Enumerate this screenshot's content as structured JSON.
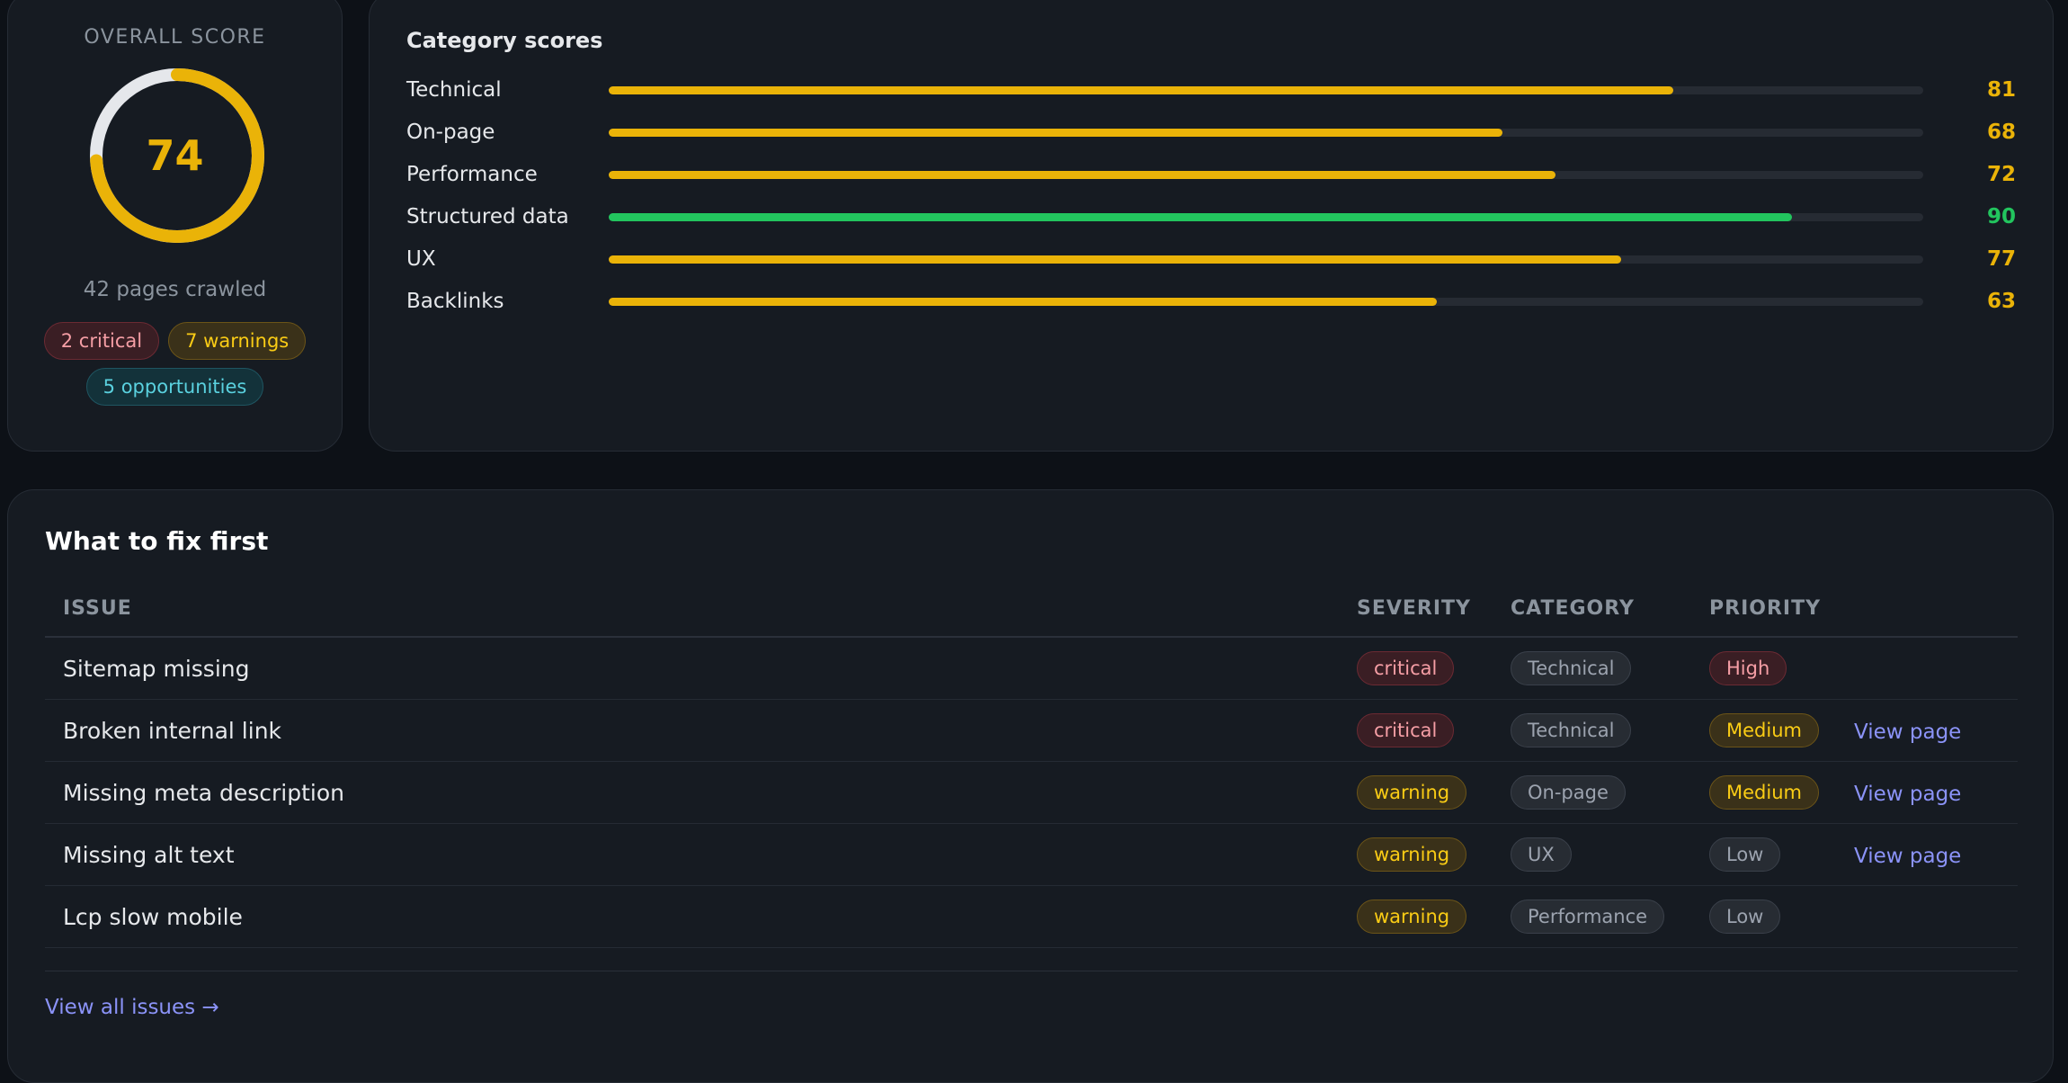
{
  "overall": {
    "title": "OVERALL SCORE",
    "score": 74,
    "score_label": "74",
    "pages_crawled": "42 pages crawled",
    "badges": {
      "critical": "2 critical",
      "warnings": "7 warnings",
      "opportunities": "5 opportunities"
    },
    "ring_color": "#eab308",
    "ring_track_color": "#e5e7eb"
  },
  "categories": {
    "title": "Category scores",
    "max": 100,
    "items": [
      {
        "label": "Technical",
        "value": 81,
        "value_text": "81",
        "color": "#eab308"
      },
      {
        "label": "On-page",
        "value": 68,
        "value_text": "68",
        "color": "#eab308"
      },
      {
        "label": "Performance",
        "value": 72,
        "value_text": "72",
        "color": "#eab308"
      },
      {
        "label": "Structured data",
        "value": 90,
        "value_text": "90",
        "color": "#22c55e"
      },
      {
        "label": "UX",
        "value": 77,
        "value_text": "77",
        "color": "#eab308"
      },
      {
        "label": "Backlinks",
        "value": 63,
        "value_text": "63",
        "color": "#eab308"
      }
    ]
  },
  "fix_first": {
    "title": "What to fix first",
    "columns": {
      "issue": "ISSUE",
      "severity": "SEVERITY",
      "category": "CATEGORY",
      "priority": "PRIORITY"
    },
    "rows": [
      {
        "issue": "Sitemap missing",
        "severity": "critical",
        "category": "Technical",
        "priority": "High",
        "link": ""
      },
      {
        "issue": "Broken internal link",
        "severity": "critical",
        "category": "Technical",
        "priority": "Medium",
        "link": "View page"
      },
      {
        "issue": "Missing meta description",
        "severity": "warning",
        "category": "On-page",
        "priority": "Medium",
        "link": "View page"
      },
      {
        "issue": "Missing alt text",
        "severity": "warning",
        "category": "UX",
        "priority": "Low",
        "link": "View page"
      },
      {
        "issue": "Lcp slow mobile",
        "severity": "warning",
        "category": "Performance",
        "priority": "Low",
        "link": ""
      }
    ],
    "view_all": "View all issues →"
  }
}
